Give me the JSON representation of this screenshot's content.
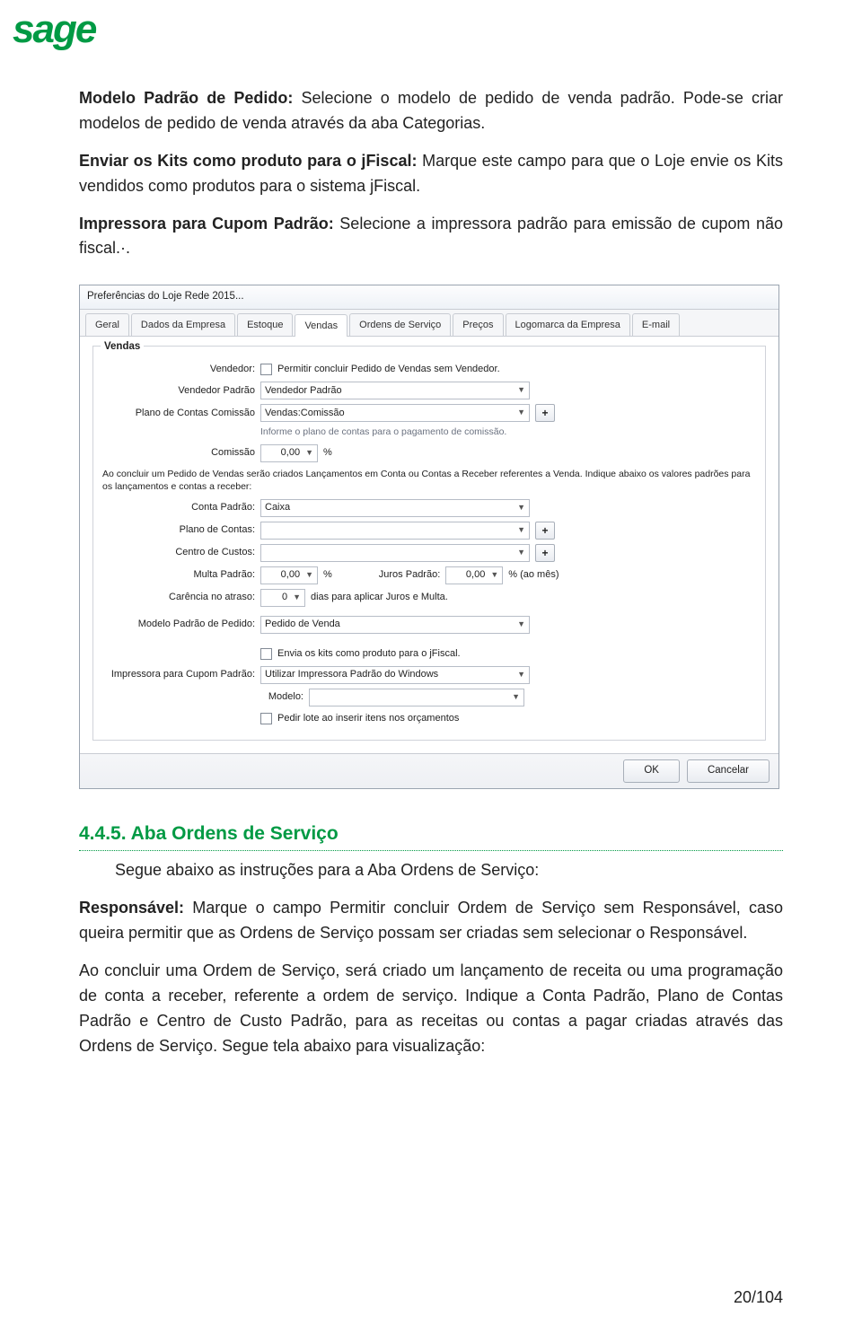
{
  "logo": "sage",
  "body": {
    "p1_bold": "Modelo Padrão de Pedido:",
    "p1_rest": " Selecione o modelo de pedido de venda padrão. Pode-se criar modelos de pedido de venda através da aba Categorias.",
    "p2_bold": "Enviar os Kits como produto para o jFiscal:",
    "p2_rest": " Marque este campo para que o Loje envie os Kits vendidos como produtos para o sistema jFiscal.",
    "p3_bold": "Impressora para Cupom Padrão:",
    "p3_rest": " Selecione a impressora padrão para emissão de cupom não fiscal.·."
  },
  "win": {
    "title": "Preferências do Loje Rede 2015...",
    "tabs": [
      "Geral",
      "Dados da Empresa",
      "Estoque",
      "Vendas",
      "Ordens de Serviço",
      "Preços",
      "Logomarca da Empresa",
      "E-mail"
    ],
    "active_tab": 3,
    "group": "Vendas",
    "vendedor_label": "Vendedor:",
    "vendedor_chk": "Permitir concluir Pedido de Vendas sem Vendedor.",
    "vendedor_padrao_label": "Vendedor Padrão",
    "vendedor_padrao_val": "Vendedor Padrão",
    "plano_comissao_label": "Plano de Contas Comissão",
    "plano_comissao_val": "Vendas:Comissão",
    "plano_hint": "Informe o plano de contas para o pagamento de comissão.",
    "comissao_label": "Comissão",
    "comissao_val": "0,00",
    "comissao_pct": "%",
    "longtext": "Ao concluir um Pedido de Vendas serão criados Lançamentos em Conta ou Contas a Receber referentes a Venda. Indique abaixo os valores padrões para os lançamentos e contas a receber:",
    "conta_padrao_label": "Conta Padrão:",
    "conta_padrao_val": "Caixa",
    "plano_contas_label": "Plano de Contas:",
    "centro_custos_label": "Centro de Custos:",
    "multa_label": "Multa Padrão:",
    "multa_val": "0,00",
    "juros_label": "Juros Padrão:",
    "juros_val": "0,00",
    "juros_unit": "% (ao mês)",
    "carencia_label": "Carência no atraso:",
    "carencia_val": "0",
    "carencia_unit": "dias para aplicar Juros e Multa.",
    "modelo_pedido_label": "Modelo Padrão de Pedido:",
    "modelo_pedido_val": "Pedido de Venda",
    "chk_kits": "Envia os kits como produto para o jFiscal.",
    "impressora_label": "Impressora para Cupom Padrão:",
    "impressora_val": "Utilizar Impressora Padrão do Windows",
    "modelo_label": "Modelo:",
    "chk_lote": "Pedir lote ao inserir itens nos orçamentos",
    "ok": "OK",
    "cancel": "Cancelar"
  },
  "section": {
    "num": "4.4.5.",
    "title": " Aba Ordens de Serviço",
    "intro": "Segue abaixo as instruções para a Aba Ordens de Serviço:",
    "p1_bold": "Responsável:",
    "p1_rest": " Marque o campo Permitir concluir Ordem de Serviço sem Responsável, caso queira permitir que as Ordens de Serviço possam ser criadas sem selecionar o Responsável.",
    "p2": "Ao concluir uma Ordem de Serviço, será criado um lançamento de receita ou uma programação de conta a receber, referente a ordem de serviço. Indique a Conta Padrão, Plano de Contas Padrão e Centro de Custo Padrão, para as receitas ou contas a pagar criadas através das Ordens de Serviço. Segue tela abaixo para visualização:"
  },
  "pagenum": "20/104"
}
